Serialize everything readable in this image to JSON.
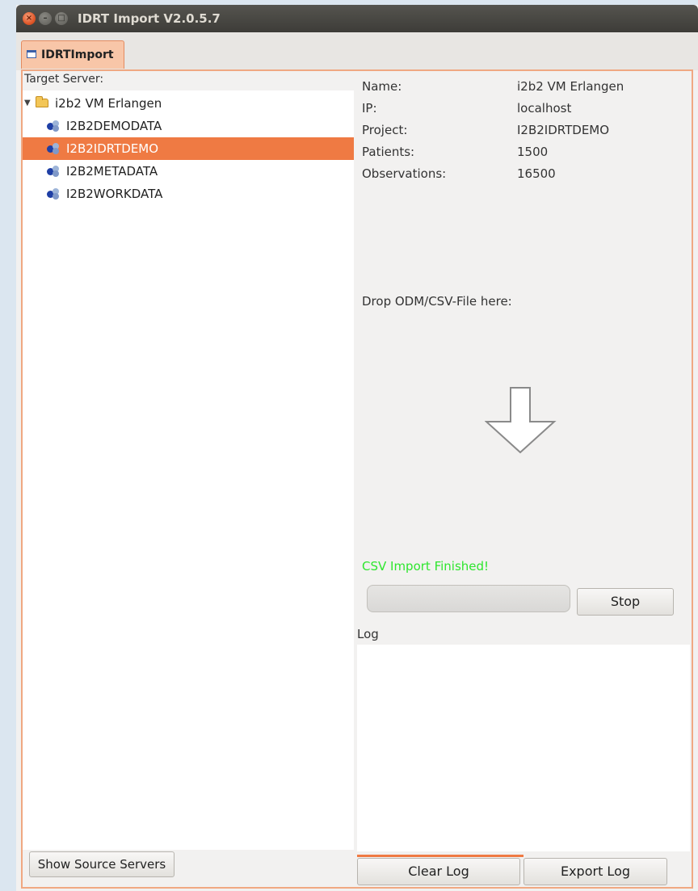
{
  "window": {
    "title": "IDRT Import V2.0.5.7",
    "controls": {
      "close": "×",
      "minimize": "–",
      "maximize": "□"
    }
  },
  "tab": {
    "label": "IDRTImport",
    "icon": "window-icon"
  },
  "left": {
    "target_label": "Target Server:",
    "tree": {
      "root": {
        "label": "i2b2 VM Erlangen",
        "icon": "folder-open-icon",
        "expanded": true,
        "expander": "▼"
      },
      "children": [
        {
          "label": "I2B2DEMODATA",
          "icon": "database-project-icon",
          "selected": false
        },
        {
          "label": "I2B2IDRTDEMO",
          "icon": "database-project-icon",
          "selected": true
        },
        {
          "label": "I2B2METADATA",
          "icon": "database-project-icon",
          "selected": false
        },
        {
          "label": "I2B2WORKDATA",
          "icon": "database-project-icon",
          "selected": false
        }
      ]
    },
    "show_source_button": "Show Source Servers"
  },
  "right": {
    "info": [
      {
        "key": "Name:",
        "value": "i2b2 VM Erlangen"
      },
      {
        "key": "IP:",
        "value": "localhost"
      },
      {
        "key": "Project:",
        "value": "I2B2IDRTDEMO"
      },
      {
        "key": "Patients:",
        "value": "1500"
      },
      {
        "key": "Observations:",
        "value": "16500"
      }
    ],
    "drop_label": "Drop ODM/CSV-File here:",
    "drop_icon": "down-arrow-icon",
    "status_text": "CSV Import Finished!",
    "status_color": "#2ee62e",
    "progress": 0,
    "stop_button": "Stop",
    "log_label": "Log",
    "log_text": "",
    "clear_log_button": "Clear Log",
    "export_log_button": "Export Log"
  },
  "colors": {
    "accent": "#ef7a43",
    "tab_bg": "#f8c6a8",
    "titlebar": "#3d3c38"
  }
}
